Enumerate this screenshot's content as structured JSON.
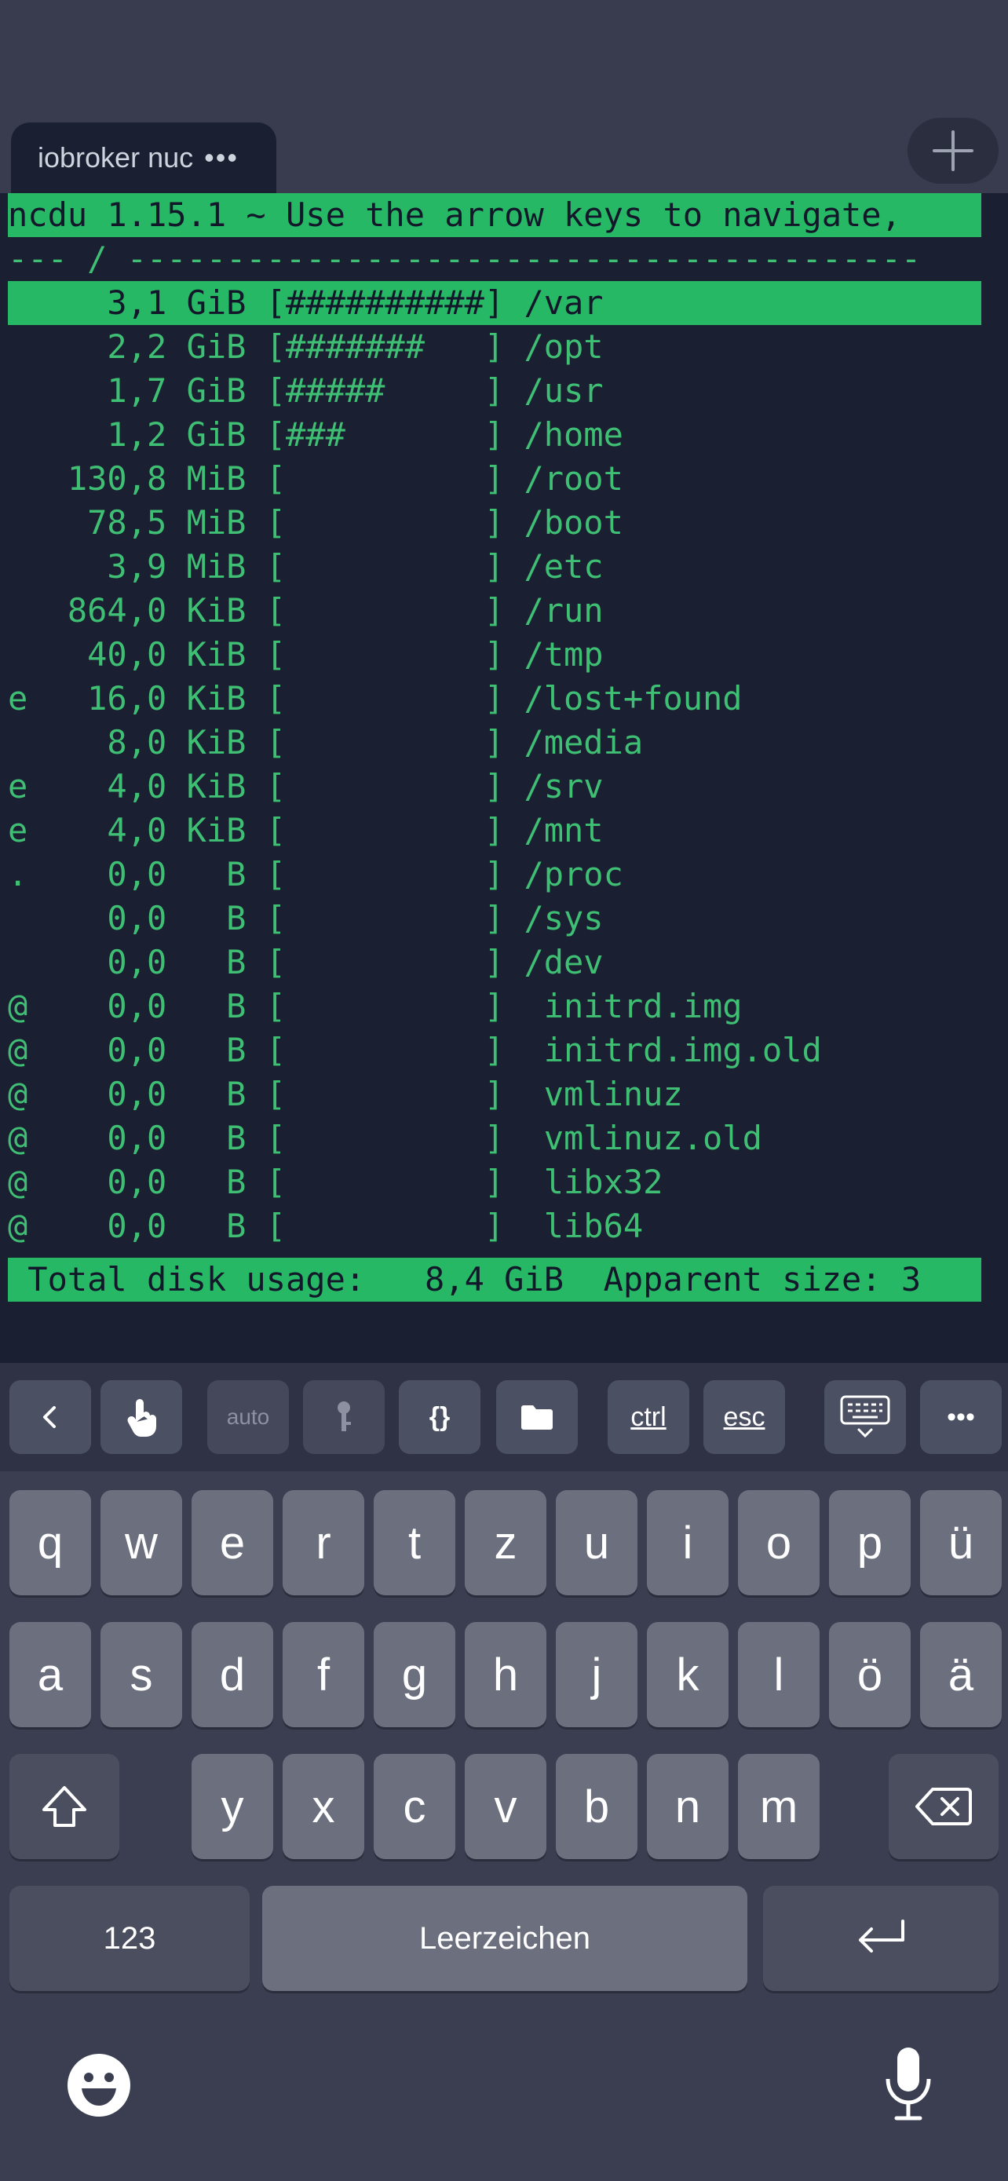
{
  "tab": {
    "title": "iobroker nuc",
    "dots": "•••"
  },
  "terminal": {
    "lines": [
      "ncdu 1.15.1 ~ Use the arrow keys to navigate,",
      "--- / ----------------------------------------",
      "     3,1 GiB [##########] /var",
      "     2,2 GiB [#######   ] /opt",
      "     1,7 GiB [#####     ] /usr",
      "     1,2 GiB [###       ] /home",
      "   130,8 MiB [          ] /root",
      "    78,5 MiB [          ] /boot",
      "     3,9 MiB [          ] /etc",
      "   864,0 KiB [          ] /run",
      "    40,0 KiB [          ] /tmp",
      "e   16,0 KiB [          ] /lost+found",
      "     8,0 KiB [          ] /media",
      "e    4,0 KiB [          ] /srv",
      "e    4,0 KiB [          ] /mnt",
      ".    0,0   B [          ] /proc",
      "     0,0   B [          ] /sys",
      "     0,0   B [          ] /dev",
      "@    0,0   B [          ]  initrd.img",
      "@    0,0   B [          ]  initrd.img.old",
      "@    0,0   B [          ]  vmlinuz",
      "@    0,0   B [          ]  vmlinuz.old",
      "@    0,0   B [          ]  libx32",
      "@    0,0   B [          ]  lib64",
      " Total disk usage:   8,4 GiB  Apparent size: 3"
    ]
  },
  "accessory": {
    "back_icon": "chevron-left-icon",
    "touch_icon": "touch-icon",
    "auto_label": "auto",
    "key_icon": "key-icon",
    "braces_label": "{}",
    "folder_icon": "folder-icon",
    "ctrl_label": "ctrl",
    "esc_label": "esc",
    "keyboard_icon": "keyboard-hide-icon",
    "more_label": "•••"
  },
  "keyboard": {
    "row1": [
      "q",
      "w",
      "e",
      "r",
      "t",
      "z",
      "u",
      "i",
      "o",
      "p",
      "ü"
    ],
    "row2": [
      "a",
      "s",
      "d",
      "f",
      "g",
      "h",
      "j",
      "k",
      "l",
      "ö",
      "ä"
    ],
    "row3": [
      "y",
      "x",
      "c",
      "v",
      "b",
      "n",
      "m"
    ],
    "num_label": "123",
    "space_label": "Leerzeichen",
    "shift_icon": "shift-icon",
    "backspace_icon": "backspace-icon",
    "return_icon": "return-icon",
    "emoji_icon": "emoji-icon",
    "mic_icon": "microphone-icon"
  }
}
